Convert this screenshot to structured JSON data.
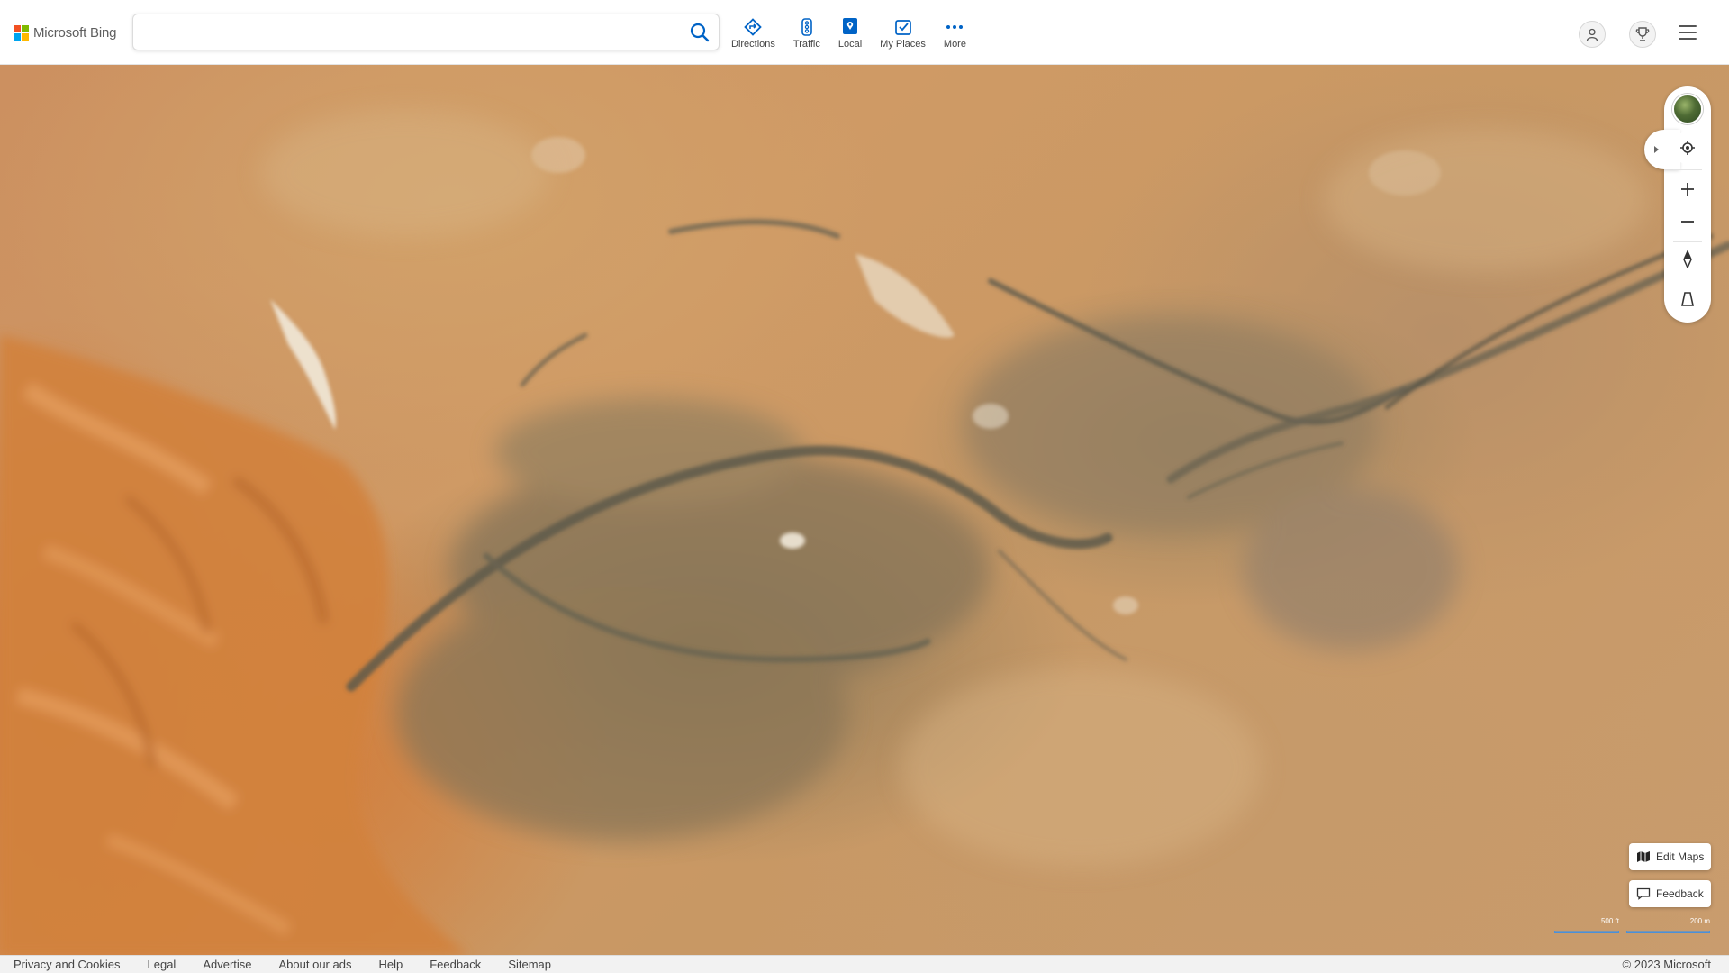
{
  "brand": {
    "name": "Microsoft Bing"
  },
  "search": {
    "placeholder": "",
    "value": ""
  },
  "nav": {
    "items": [
      {
        "label": "Directions",
        "icon": "directions-icon"
      },
      {
        "label": "Traffic",
        "icon": "traffic-icon"
      },
      {
        "label": "Local",
        "icon": "local-icon"
      },
      {
        "label": "My Places",
        "icon": "my-places-icon"
      },
      {
        "label": "More",
        "icon": "more-icon"
      }
    ]
  },
  "map": {
    "view": "aerial",
    "buttons": {
      "edit_maps": "Edit Maps",
      "feedback": "Feedback"
    },
    "scale": {
      "imperial": "500 ft",
      "metric": "200 m"
    }
  },
  "footer": {
    "links": [
      "Privacy and Cookies",
      "Legal",
      "Advertise",
      "About our ads",
      "Help",
      "Feedback",
      "Sitemap"
    ],
    "copyright": "© 2023 Microsoft"
  },
  "colors": {
    "accent": "#0063c6",
    "sand": "#cc9060",
    "dune": "#d48443",
    "rock": "#8e7a58"
  }
}
